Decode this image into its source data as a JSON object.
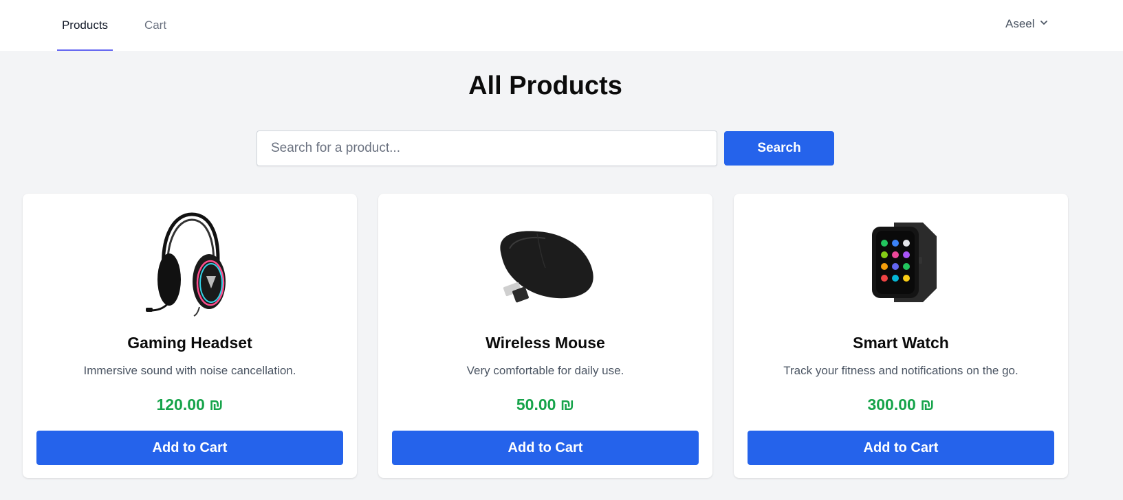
{
  "nav": {
    "tabs": [
      {
        "label": "Products",
        "active": true
      },
      {
        "label": "Cart",
        "active": false
      }
    ],
    "user": {
      "name": "Aseel",
      "icon": "chevron-down-icon"
    },
    "accent_color": "#6366f1"
  },
  "main": {
    "title": "All Products",
    "search": {
      "placeholder": "Search for a product...",
      "value": "",
      "button_label": "Search"
    }
  },
  "products": [
    {
      "name": "Gaming Headset",
      "description": "Immersive sound with noise cancellation.",
      "price": "120.00 ₪",
      "button_label": "Add to Cart",
      "image": "headset-image"
    },
    {
      "name": "Wireless Mouse",
      "description": "Very comfortable for daily use.",
      "price": "50.00 ₪",
      "button_label": "Add to Cart",
      "image": "mouse-image"
    },
    {
      "name": "Smart Watch",
      "description": "Track your fitness and notifications on the go.",
      "price": "300.00 ₪",
      "button_label": "Add to Cart",
      "image": "watch-image"
    }
  ],
  "colors": {
    "primary_button": "#2563eb",
    "price": "#16a34a",
    "background": "#f3f4f6"
  }
}
